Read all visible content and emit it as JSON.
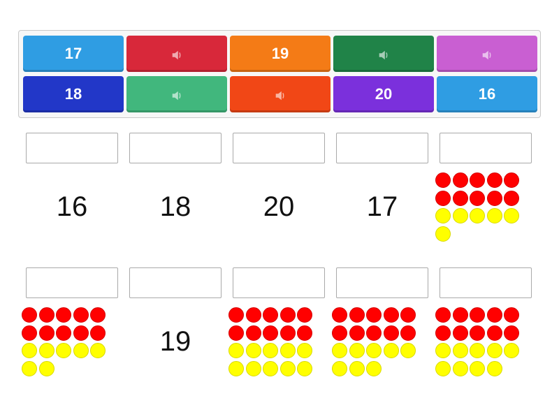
{
  "colors": {
    "tray_border": "#c8c8c8",
    "red_dot": "#ff0000",
    "yellow_dot": "#ffff00"
  },
  "tiles": [
    {
      "label": "17",
      "kind": "text",
      "color": "#2f9de3"
    },
    {
      "label": "",
      "kind": "audio",
      "icon": "speaker-icon",
      "color": "#d8283a"
    },
    {
      "label": "19",
      "kind": "text",
      "color": "#f47b16"
    },
    {
      "label": "",
      "kind": "audio",
      "icon": "speaker-icon",
      "color": "#208348"
    },
    {
      "label": "",
      "kind": "audio",
      "icon": "speaker-icon",
      "color": "#c95fd2"
    },
    {
      "label": "18",
      "kind": "text",
      "color": "#2237c8"
    },
    {
      "label": "",
      "kind": "audio",
      "icon": "speaker-icon",
      "color": "#41b77d"
    },
    {
      "label": "",
      "kind": "audio",
      "icon": "speaker-icon",
      "color": "#f14716"
    },
    {
      "label": "20",
      "kind": "text",
      "color": "#7b30dc"
    },
    {
      "label": "16",
      "kind": "text",
      "color": "#2f9de3"
    }
  ],
  "cards": [
    {
      "type": "number",
      "value": "16"
    },
    {
      "type": "number",
      "value": "18"
    },
    {
      "type": "number",
      "value": "20"
    },
    {
      "type": "number",
      "value": "17"
    },
    {
      "type": "dots",
      "red": 10,
      "yellow": 6
    },
    {
      "type": "dots",
      "red": 10,
      "yellow": 7
    },
    {
      "type": "number",
      "value": "19"
    },
    {
      "type": "dots",
      "red": 10,
      "yellow": 10
    },
    {
      "type": "dots",
      "red": 10,
      "yellow": 8
    },
    {
      "type": "dots",
      "red": 10,
      "yellow": 9
    }
  ]
}
